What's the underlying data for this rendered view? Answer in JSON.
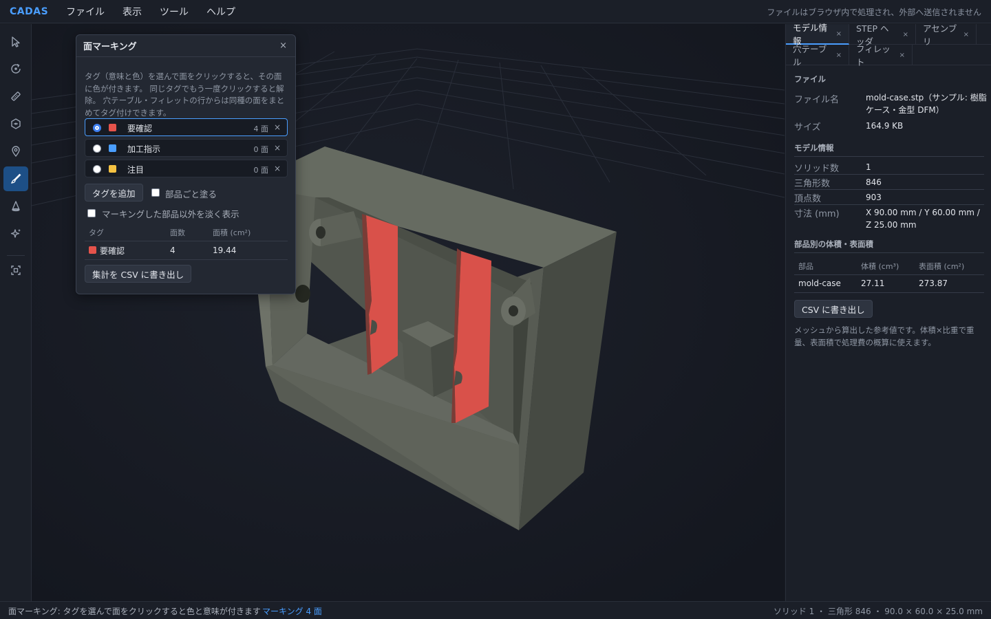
{
  "app": {
    "brand": "CADAS",
    "menu": [
      "ファイル",
      "表示",
      "ツール",
      "ヘルプ"
    ],
    "privacy_note": "ファイルはブラウザ内で処理され、外部へ送信されません"
  },
  "toolbar": {
    "tools": [
      {
        "name": "select-tool",
        "icon": "cursor-icon"
      },
      {
        "name": "orbit-tool",
        "icon": "orbit-icon"
      },
      {
        "name": "measure-tool",
        "icon": "ruler-icon"
      },
      {
        "name": "section-tool",
        "icon": "hexagon-icon"
      },
      {
        "name": "pin-tool",
        "icon": "map-pin-icon"
      },
      {
        "name": "face-marking-tool",
        "icon": "brush-icon",
        "active": true
      },
      {
        "name": "draft-tool",
        "icon": "cone-icon"
      },
      {
        "name": "ai-tool",
        "icon": "sparkle-icon"
      },
      {
        "name": "fit-view-tool",
        "icon": "frame-icon"
      }
    ]
  },
  "marking_panel": {
    "title": "面マーキング",
    "close": "×",
    "description": "タグ（意味と色）を選んで面をクリックすると、その面に色が付きます。 同じタグでもう一度クリックすると解除。 穴テーブル・フィレットの行からは同種の面をまとめてタグ付けできます。",
    "tags": [
      {
        "name": "要確認",
        "color": "#e5534b",
        "count": "4 面",
        "selected": true
      },
      {
        "name": "加工指示",
        "color": "#4a9eff",
        "count": "0 面",
        "selected": false
      },
      {
        "name": "注目",
        "color": "#f5c242",
        "count": "0 面",
        "selected": false
      }
    ],
    "remove": "×",
    "add_tag_button": "タグを追加",
    "paint_by_part_label": "部品ごと塗る",
    "dim_others_label": "マーキングした部品以外を淡く表示",
    "table": {
      "headers": [
        "タグ",
        "面数",
        "面積 (cm²)"
      ],
      "rows": [
        {
          "tag": "要確認",
          "color": "#e5534b",
          "faces": "4",
          "area": "19.44"
        }
      ]
    },
    "export_button": "集計を CSV に書き出し"
  },
  "right_panel": {
    "tabs_row1": [
      {
        "label": "モデル情報",
        "active": true
      },
      {
        "label": "STEP ヘッダ",
        "active": false
      },
      {
        "label": "アセンブリ",
        "active": false
      }
    ],
    "tabs_row2": [
      {
        "label": "穴テーブル",
        "active": false
      },
      {
        "label": "フィレット",
        "active": false
      }
    ],
    "tab_close": "×",
    "file_section": "ファイル",
    "file_name_label": "ファイル名",
    "file_name_value": "mold-case.stp（サンプル: 樹脂ケース・金型 DFM）",
    "size_label": "サイズ",
    "size_value": "164.9 KB",
    "model_section": "モデル情報",
    "solids_label": "ソリッド数",
    "solids_value": "1",
    "triangles_label": "三角形数",
    "triangles_value": "846",
    "vertices_label": "頂点数",
    "vertices_value": "903",
    "dims_label": "寸法 (mm)",
    "dims_value": "X 90.00 mm / Y 60.00 mm / Z 25.00 mm",
    "parts_section": "部品別の体積・表面積",
    "parts_headers": [
      "部品",
      "体積 (cm³)",
      "表面積 (cm²)"
    ],
    "parts_rows": [
      {
        "part": "mold-case",
        "volume": "27.11",
        "surface": "273.87"
      }
    ],
    "csv_button": "CSV に書き出し",
    "note": "メッシュから算出した参考値です。体積×比重で重量、表面積で処理費の概算に使えます。"
  },
  "status": {
    "left": "面マーキング: タグを選んで面をクリックすると色と意味が付きます",
    "mark_count": "マーキング 4 面",
    "right": "ソリッド 1 ・ 三角形 846 ・ 90.0 × 60.0 × 25.0 mm"
  },
  "colors": {
    "accent": "#4a9eff",
    "model": "#5a5e55",
    "marked_face": "#d9514a"
  }
}
